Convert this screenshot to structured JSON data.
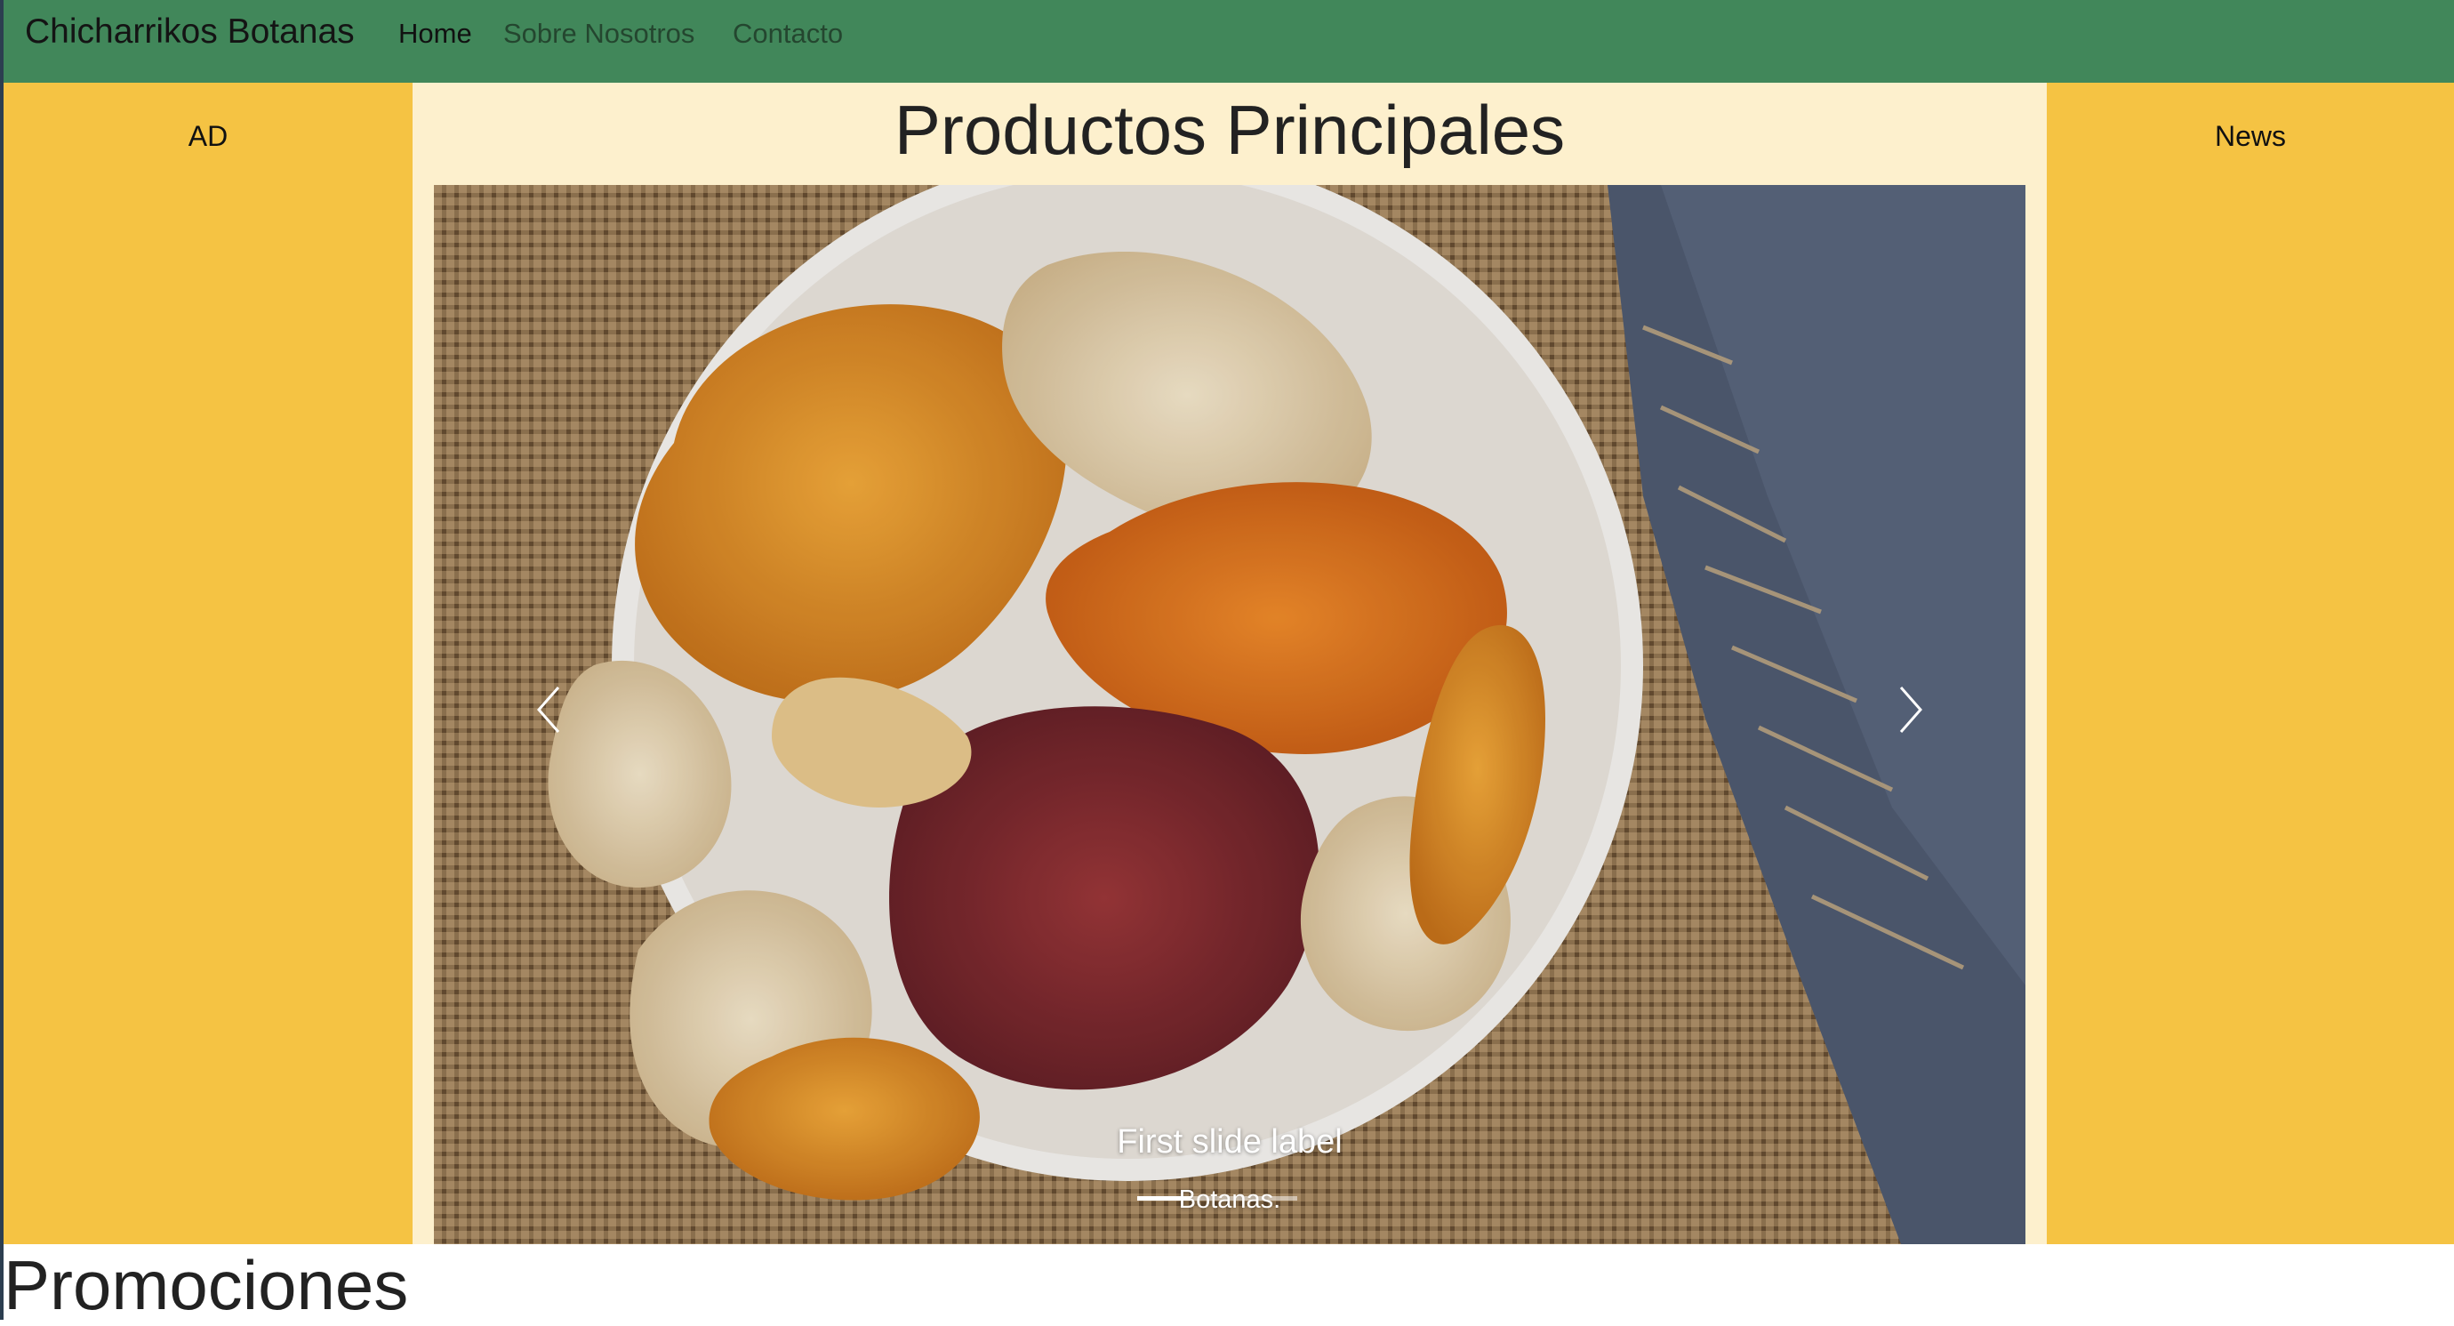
{
  "navbar": {
    "brand": "Chicharrikos Botanas",
    "links": [
      {
        "label": "Home",
        "active": true
      },
      {
        "label": "Sobre Nosotros",
        "active": false
      },
      {
        "label": "Contacto",
        "active": false
      }
    ]
  },
  "sidebar_left": {
    "label": "AD"
  },
  "sidebar_right": {
    "label": "News"
  },
  "main": {
    "title": "Productos Principales",
    "carousel": {
      "active_index": 0,
      "slide_count": 3,
      "caption_title": "First slide label",
      "caption_text": "Botanas.",
      "prev_icon": "chevron-left-icon",
      "next_icon": "chevron-right-icon"
    }
  },
  "promotions": {
    "title": "Promociones"
  },
  "colors": {
    "navbar": "#41875a",
    "sidebar": "#f5c343",
    "center_bg": "#fdf0cd"
  }
}
